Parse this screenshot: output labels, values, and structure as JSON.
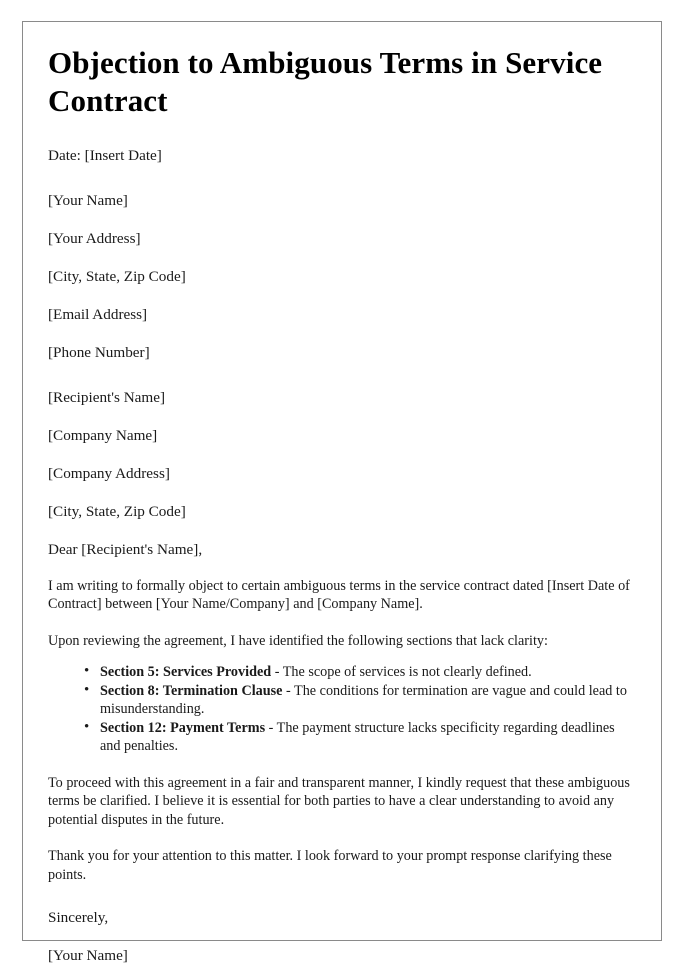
{
  "document": {
    "title": "Objection to Ambiguous Terms in Service Contract",
    "date_line": "Date: [Insert Date]",
    "sender_block": [
      "[Your Name]",
      "[Your Address]",
      "[City, State, Zip Code]",
      "[Email Address]",
      "[Phone Number]"
    ],
    "recipient_block": [
      "[Recipient's Name]",
      "[Company Name]",
      "[Company Address]",
      "[City, State, Zip Code]"
    ],
    "salutation": "Dear [Recipient's Name],",
    "intro_paragraph": "I am writing to formally object to certain ambiguous terms in the service contract dated [Insert Date of Contract] between [Your Name/Company] and [Company Name].",
    "lead_in_paragraph": "Upon reviewing the agreement, I have identified the following sections that lack clarity:",
    "issues": [
      {
        "lead": "Section 5: Services Provided",
        "detail": " - The scope of services is not clearly defined."
      },
      {
        "lead": "Section 8: Termination Clause",
        "detail": " - The conditions for termination are vague and could lead to misunderstanding."
      },
      {
        "lead": "Section 12: Payment Terms",
        "detail": " - The payment structure lacks specificity regarding deadlines and penalties."
      }
    ],
    "request_paragraph": "To proceed with this agreement in a fair and transparent manner, I kindly request that these ambiguous terms be clarified. I believe it is essential for both parties to have a clear understanding to avoid any potential disputes in the future.",
    "thanks_paragraph": "Thank you for your attention to this matter. I look forward to your prompt response clarifying these points.",
    "closing": "Sincerely,",
    "signature": "[Your Name]"
  }
}
